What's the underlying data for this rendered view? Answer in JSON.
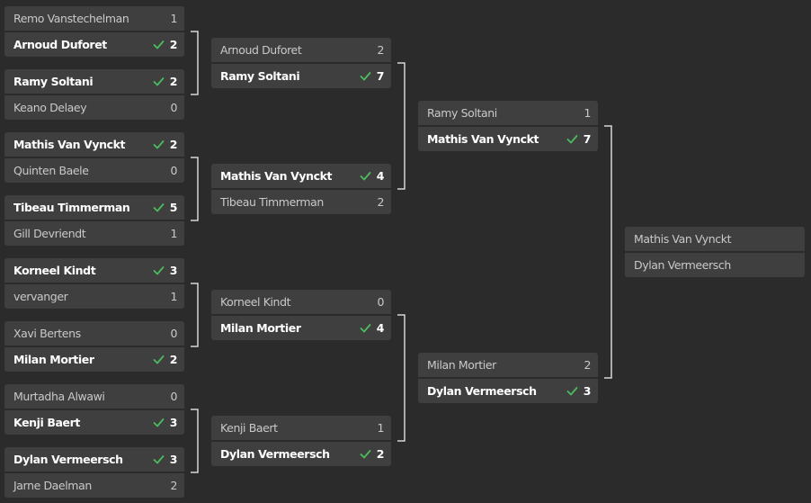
{
  "colors": {
    "background": "#2b2b2b",
    "card": "#3f3f3f",
    "text_muted": "#c9c9c9",
    "text_winner": "#ffffff",
    "check": "#4cbb5e",
    "connector": "#d6d6d6"
  },
  "rounds": [
    {
      "matches": [
        {
          "players": [
            {
              "name": "Remo Vanstechelman",
              "score": "1",
              "winner": false
            },
            {
              "name": "Arnoud Duforet",
              "score": "2",
              "winner": true
            }
          ]
        },
        {
          "players": [
            {
              "name": "Ramy Soltani",
              "score": "2",
              "winner": true
            },
            {
              "name": "Keano Delaey",
              "score": "0",
              "winner": false
            }
          ]
        },
        {
          "players": [
            {
              "name": "Mathis Van Vynckt",
              "score": "2",
              "winner": true
            },
            {
              "name": "Quinten Baele",
              "score": "0",
              "winner": false
            }
          ]
        },
        {
          "players": [
            {
              "name": "Tibeau Timmerman",
              "score": "5",
              "winner": true
            },
            {
              "name": "Gill Devriendt",
              "score": "1",
              "winner": false
            }
          ]
        },
        {
          "players": [
            {
              "name": "Korneel Kindt",
              "score": "3",
              "winner": true
            },
            {
              "name": "vervanger",
              "score": "1",
              "winner": false
            }
          ]
        },
        {
          "players": [
            {
              "name": "Xavi Bertens",
              "score": "0",
              "winner": false
            },
            {
              "name": "Milan Mortier",
              "score": "2",
              "winner": true
            }
          ]
        },
        {
          "players": [
            {
              "name": "Murtadha Alwawi",
              "score": "0",
              "winner": false
            },
            {
              "name": "Kenji Baert",
              "score": "3",
              "winner": true
            }
          ]
        },
        {
          "players": [
            {
              "name": "Dylan Vermeersch",
              "score": "3",
              "winner": true
            },
            {
              "name": "Jarne Daelman",
              "score": "2",
              "winner": false
            }
          ]
        }
      ]
    },
    {
      "matches": [
        {
          "players": [
            {
              "name": "Arnoud Duforet",
              "score": "2",
              "winner": false
            },
            {
              "name": "Ramy Soltani",
              "score": "7",
              "winner": true
            }
          ]
        },
        {
          "players": [
            {
              "name": "Mathis Van Vynckt",
              "score": "4",
              "winner": true
            },
            {
              "name": "Tibeau Timmerman",
              "score": "2",
              "winner": false
            }
          ]
        },
        {
          "players": [
            {
              "name": "Korneel Kindt",
              "score": "0",
              "winner": false
            },
            {
              "name": "Milan Mortier",
              "score": "4",
              "winner": true
            }
          ]
        },
        {
          "players": [
            {
              "name": "Kenji Baert",
              "score": "1",
              "winner": false
            },
            {
              "name": "Dylan Vermeersch",
              "score": "2",
              "winner": true
            }
          ]
        }
      ]
    },
    {
      "matches": [
        {
          "players": [
            {
              "name": "Ramy Soltani",
              "score": "1",
              "winner": false
            },
            {
              "name": "Mathis Van Vynckt",
              "score": "7",
              "winner": true
            }
          ]
        },
        {
          "players": [
            {
              "name": "Milan Mortier",
              "score": "2",
              "winner": false
            },
            {
              "name": "Dylan Vermeersch",
              "score": "3",
              "winner": true
            }
          ]
        }
      ]
    },
    {
      "matches": [
        {
          "players": [
            {
              "name": "Mathis Van Vynckt",
              "score": "",
              "winner": false
            },
            {
              "name": "Dylan Vermeersch",
              "score": "",
              "winner": false
            }
          ]
        }
      ]
    }
  ]
}
